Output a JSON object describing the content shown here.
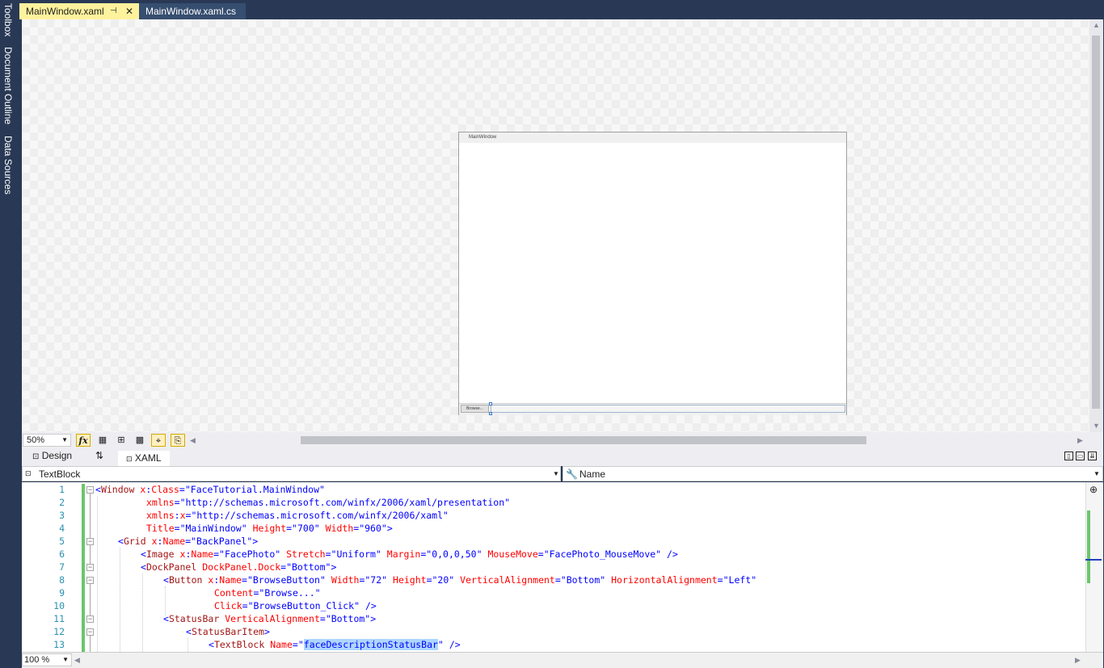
{
  "left_toolbars": [
    "Toolbox",
    "Document Outline",
    "Data Sources"
  ],
  "tabs": [
    {
      "label": "MainWindow.xaml",
      "pin": "⊣",
      "close": "✕"
    },
    {
      "label": "MainWindow.xaml.cs"
    }
  ],
  "designer": {
    "window_title": "MainWindow",
    "browse_button": "Browse...",
    "zoom": "50%"
  },
  "split": {
    "design_label": "Design",
    "xaml_label": "XAML",
    "swap_icon": "⇅"
  },
  "nav": {
    "element": "TextBlock",
    "member": "Name"
  },
  "editor": {
    "zoom": "100 %",
    "line_numbers": [
      "1",
      "2",
      "3",
      "4",
      "5",
      "6",
      "7",
      "8",
      "9",
      "10",
      "11",
      "12",
      "13"
    ]
  },
  "code_lines": [
    "<Window x:Class=\"FaceTutorial.MainWindow\"",
    "xmlns=\"http://schemas.microsoft.com/winfx/2006/xaml/presentation\"",
    "xmlns:x=\"http://schemas.microsoft.com/winfx/2006/xaml\"",
    "Title=\"MainWindow\" Height=\"700\" Width=\"960\">",
    "<Grid x:Name=\"BackPanel\">",
    "<Image x:Name=\"FacePhoto\" Stretch=\"Uniform\" Margin=\"0,0,0,50\" MouseMove=\"FacePhoto_MouseMove\" />",
    "<DockPanel DockPanel.Dock=\"Bottom\">",
    "<Button x:Name=\"BrowseButton\" Width=\"72\" Height=\"20\" VerticalAlignment=\"Bottom\" HorizontalAlignment=\"Left\"",
    "Content=\"Browse...\"",
    "Click=\"BrowseButton_Click\" />",
    "<StatusBar VerticalAlignment=\"Bottom\">",
    "<StatusBarItem>",
    "<TextBlock Name=\"faceDescriptionStatusBar\" />"
  ],
  "colors": {
    "chrome": "#293955",
    "active_tab": "#fff29d",
    "xml_tag": "#a31515",
    "xml_attr": "#ff0000",
    "xml_value": "#0000ff",
    "line_number": "#2b91af",
    "change_bar": "#6cc66c"
  },
  "icons": [
    "pin-icon",
    "close-icon",
    "formula-icon",
    "grid-icon",
    "snap-grid-icon",
    "artboard-icon",
    "snap-lines-icon",
    "project-code-icon",
    "swap-icon",
    "xaml-icon",
    "element-icon",
    "wrench-icon"
  ]
}
